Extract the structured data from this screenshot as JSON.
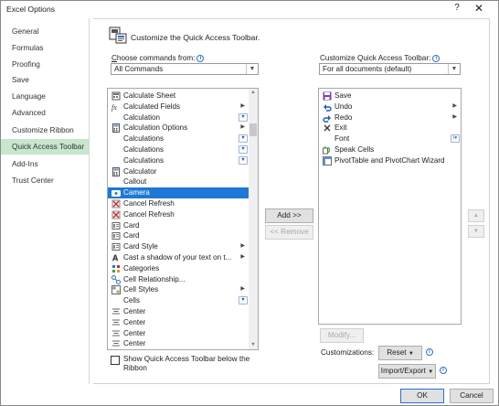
{
  "window": {
    "title": "Excel Options",
    "help_glyph": "?",
    "close_glyph": "✕"
  },
  "nav": {
    "items": [
      {
        "label": "General"
      },
      {
        "label": "Formulas"
      },
      {
        "label": "Proofing"
      },
      {
        "label": "Save"
      },
      {
        "label": "Language"
      },
      {
        "label": "Advanced"
      },
      {
        "label": "Customize Ribbon"
      },
      {
        "label": "Quick Access Toolbar",
        "selected": true
      },
      {
        "label": "Add-Ins"
      },
      {
        "label": "Trust Center"
      }
    ]
  },
  "header": {
    "text": "Customize the Quick Access Toolbar.",
    "icon": "quick-access-toolbar-icon"
  },
  "left": {
    "choose_label": "Choose commands from:",
    "choose_value": "All Commands",
    "commands": [
      {
        "label": "Calculate Sheet",
        "icon": "calculate-sheet-icon"
      },
      {
        "label": "Calculated Fields",
        "icon": "fx-icon",
        "submenu": true
      },
      {
        "label": "Calculation",
        "icon": "none",
        "dropdown": true
      },
      {
        "label": "Calculation Options",
        "icon": "calculator-icon",
        "submenu": true
      },
      {
        "label": "Calculations",
        "icon": "none",
        "dropdown": true
      },
      {
        "label": "Calculations",
        "icon": "none",
        "dropdown": true
      },
      {
        "label": "Calculations",
        "icon": "none",
        "dropdown": true
      },
      {
        "label": "Calculator",
        "icon": "calculator-icon"
      },
      {
        "label": "Callout",
        "icon": "none"
      },
      {
        "label": "Camera",
        "icon": "camera-icon",
        "selected": true
      },
      {
        "label": "Cancel Refresh",
        "icon": "cancel-refresh-icon"
      },
      {
        "label": "Cancel Refresh",
        "icon": "cancel-refresh-icon"
      },
      {
        "label": "Card",
        "icon": "card-icon"
      },
      {
        "label": "Card",
        "icon": "card-icon"
      },
      {
        "label": "Card Style",
        "icon": "card-icon",
        "submenu": true
      },
      {
        "label": "Cast a shadow of your text on t...",
        "icon": "text-shadow-icon",
        "submenu": true
      },
      {
        "label": "Categories",
        "icon": "categories-icon"
      },
      {
        "label": "Cell Relationship...",
        "icon": "relationship-icon"
      },
      {
        "label": "Cell Styles",
        "icon": "cell-styles-icon",
        "submenu": true
      },
      {
        "label": "Cells",
        "icon": "none",
        "dropdown": true
      },
      {
        "label": "Center",
        "icon": "center-icon"
      },
      {
        "label": "Center",
        "icon": "center-icon"
      },
      {
        "label": "Center",
        "icon": "center-icon"
      },
      {
        "label": "Center",
        "icon": "center-icon"
      }
    ],
    "show_below_label_line1": "Show Quick Access Toolbar below the",
    "show_below_label_line2": "Ribbon"
  },
  "middle": {
    "add_label": "Add >>",
    "remove_label": "<< Remove"
  },
  "right": {
    "customize_label": "Customize Quick Access Toolbar:",
    "customize_value": "For all documents (default)",
    "items": [
      {
        "label": "Save",
        "icon": "save-icon"
      },
      {
        "label": "Undo",
        "icon": "undo-icon",
        "submenu": true
      },
      {
        "label": "Redo",
        "icon": "redo-icon",
        "submenu": true
      },
      {
        "label": "Exit",
        "icon": "exit-icon"
      },
      {
        "label": "Font",
        "icon": "none",
        "font_control": true
      },
      {
        "label": "Speak Cells",
        "icon": "speak-cells-icon"
      },
      {
        "label": "PivotTable and PivotChart Wizard",
        "icon": "pivot-wizard-icon"
      }
    ],
    "modify_label": "Modify...",
    "customizations_label": "Customizations:",
    "reset_label": "Reset",
    "import_export_label": "Import/Export",
    "move_up_glyph": "▲",
    "move_down_glyph": "▼"
  },
  "footer": {
    "ok_label": "OK",
    "cancel_label": "Cancel"
  },
  "colors": {
    "accent": "#1f78d6",
    "nav_selected": "#c6e6ce"
  }
}
